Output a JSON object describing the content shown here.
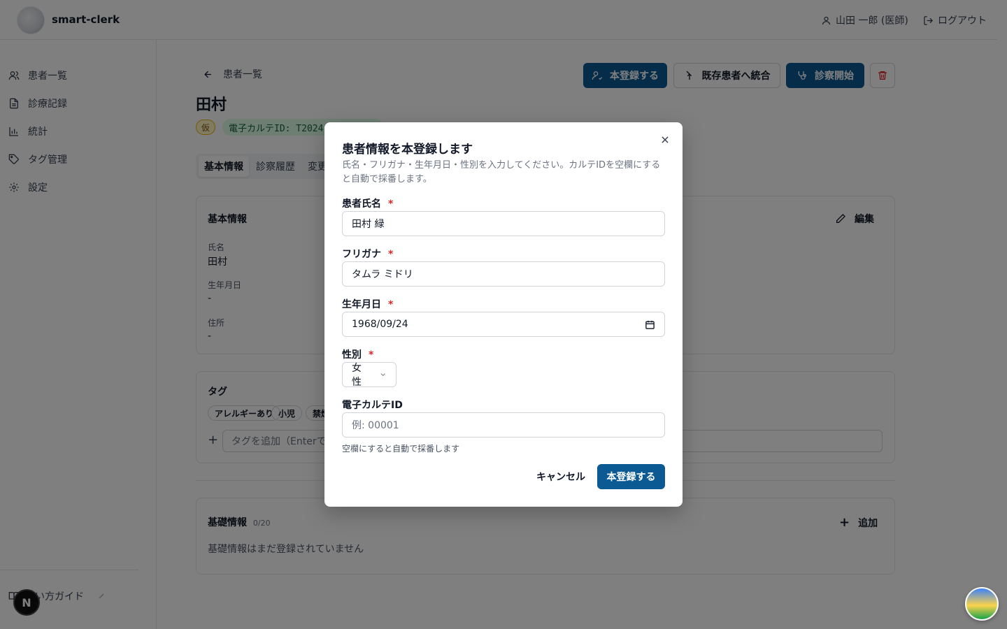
{
  "header": {
    "app_name": "smart-clerk",
    "user_label": "山田 一郎 (医師)",
    "logout_label": "ログアウト"
  },
  "sidebar": {
    "items": [
      {
        "label": "患者一覧",
        "icon": "users-icon"
      },
      {
        "label": "診療記録",
        "icon": "file-text-icon"
      },
      {
        "label": "統計",
        "icon": "bar-chart-icon"
      },
      {
        "label": "タグ管理",
        "icon": "tag-icon"
      },
      {
        "label": "設定",
        "icon": "gear-icon"
      }
    ],
    "guide_label": "使い方ガイド"
  },
  "main": {
    "back_label": "患者一覧",
    "actions": {
      "register_label": "本登録する",
      "merge_label": "既存患者へ統合",
      "start_exam_label": "診察開始"
    },
    "patient_name": "田村",
    "temp_badge": "仮",
    "karte_id_badge": "電子カルテID: T2024",
    "tabs": [
      "基本情報",
      "診察履歴",
      "変更"
    ],
    "basic_info": {
      "title": "基本情報",
      "edit_label": "編集",
      "fields": [
        {
          "label": "氏名",
          "value": "田村"
        },
        {
          "label": "生年月日",
          "value": "-"
        },
        {
          "label": "住所",
          "value": "-"
        }
      ]
    },
    "tags": {
      "title": "タグ",
      "chips": [
        "アレルギーあり",
        "小児",
        "禁煙"
      ],
      "input_placeholder": "タグを追加（Enterで確"
    },
    "foundation": {
      "title": "基礎情報",
      "count": "0/20",
      "add_label": "追加",
      "empty_text": "基礎情報はまだ登録されていません"
    }
  },
  "modal": {
    "title": "患者情報を本登録します",
    "description": "氏名・フリガナ・生年月日・性別を入力してください。カルテIDを空欄にすると自動で採番します。",
    "required_mark": "*",
    "name_label": "患者氏名",
    "name_value": "田村 緑",
    "kana_label": "フリガナ",
    "kana_value": "タムラ ミドリ",
    "dob_label": "生年月日",
    "dob_value": "1968/09/24",
    "sex_label": "性別",
    "sex_value": "女性",
    "karte_id_label": "電子カルテID",
    "karte_id_placeholder": "例: 00001",
    "karte_id_hint": "空欄にすると自動で採番します",
    "cancel_label": "キャンセル",
    "submit_label": "本登録する"
  },
  "colors": {
    "primary": "#0b5a94",
    "required": "#dc2626",
    "overlay": "rgba(0,0,0,0.5)"
  }
}
